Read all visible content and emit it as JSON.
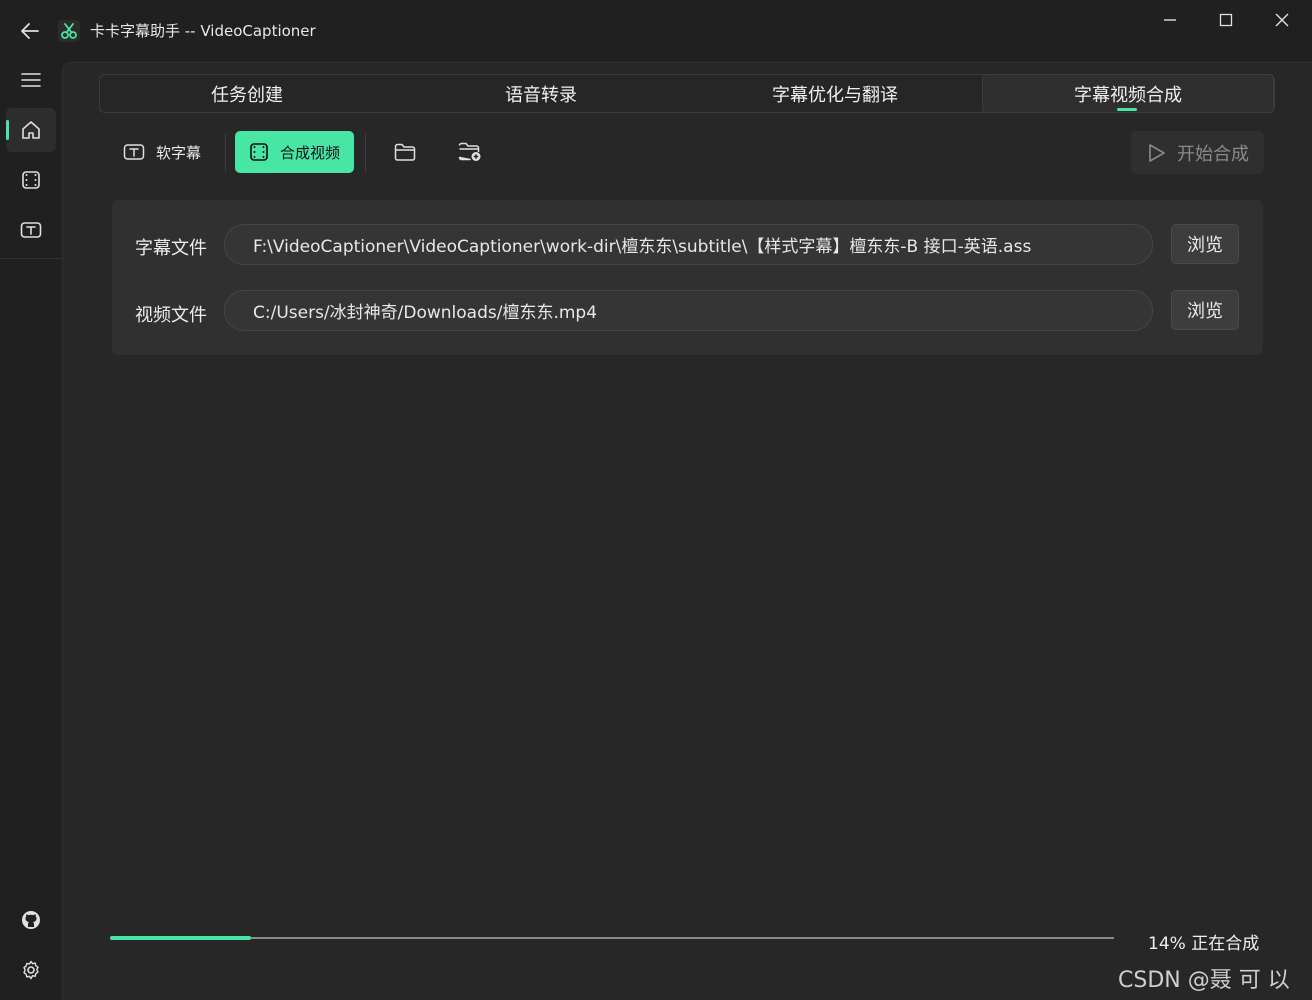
{
  "window": {
    "title": "卡卡字幕助手 -- VideoCaptioner",
    "accent_color": "#47e6a4"
  },
  "sidebar": {
    "items": [
      {
        "icon": "menu-icon"
      },
      {
        "icon": "home-icon",
        "active": true
      },
      {
        "icon": "film-icon"
      },
      {
        "icon": "subtitle-icon"
      }
    ],
    "bottom": [
      {
        "icon": "github-icon"
      },
      {
        "icon": "settings-icon"
      }
    ]
  },
  "tabs": [
    {
      "label": "任务创建"
    },
    {
      "label": "语音转录"
    },
    {
      "label": "字幕优化与翻译"
    },
    {
      "label": "字幕视频合成",
      "active": true
    }
  ],
  "toolbar": {
    "soft_subtitle_label": "软字幕",
    "synthesize_video_label": "合成视频",
    "start_label": "开始合成"
  },
  "files": {
    "subtitle_label": "字幕文件",
    "subtitle_path": "F:\\VideoCaptioner\\VideoCaptioner\\work-dir\\檀东东\\subtitle\\【样式字幕】檀东东-B 接口-英语.ass",
    "video_label": "视频文件",
    "video_path": "C:/Users/冰封神奇/Downloads/檀东东.mp4",
    "browse_label": "浏览"
  },
  "progress": {
    "percent": 14,
    "text": "14% 正在合成"
  },
  "watermark": "CSDN @聂 可 以"
}
